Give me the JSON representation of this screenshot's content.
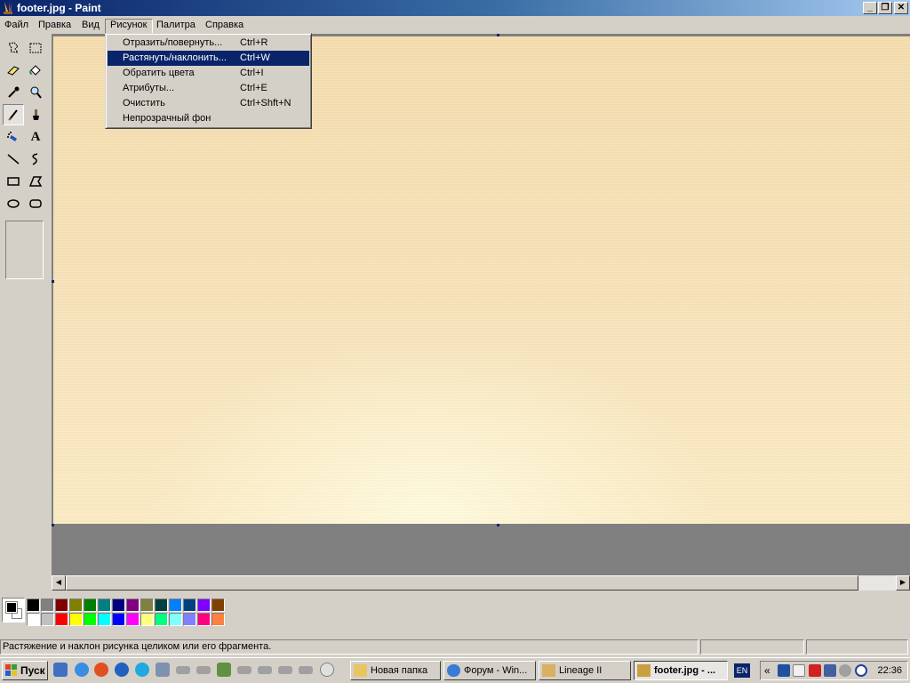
{
  "window": {
    "title": "footer.jpg - Paint",
    "buttons": {
      "minimize": "_",
      "restore": "❐",
      "close": "✕"
    }
  },
  "menubar": {
    "items": [
      "Файл",
      "Правка",
      "Вид",
      "Рисунок",
      "Палитра",
      "Справка"
    ],
    "open_menu": "Рисунок"
  },
  "dropdown": {
    "items": [
      {
        "label": "Отразить/повернуть...",
        "shortcut": "Ctrl+R"
      },
      {
        "label": "Растянуть/наклонить...",
        "shortcut": "Ctrl+W"
      },
      {
        "label": "Обратить цвета",
        "shortcut": "Ctrl+I"
      },
      {
        "label": "Атрибуты...",
        "shortcut": "Ctrl+E"
      },
      {
        "label": "Очистить",
        "shortcut": "Ctrl+Shft+N"
      },
      {
        "label": "Непрозрачный фон",
        "shortcut": ""
      }
    ],
    "highlighted_index": 1
  },
  "toolbox": {
    "tools": [
      "free-select",
      "rect-select",
      "eraser",
      "fill",
      "color-picker",
      "magnifier",
      "pencil",
      "brush",
      "airbrush",
      "text",
      "line",
      "curve",
      "rectangle",
      "polygon",
      "ellipse",
      "rounded-rectangle"
    ],
    "text_tool_glyph": "A",
    "active_tool": "pencil"
  },
  "palette": {
    "row1": [
      "#000000",
      "#808080",
      "#800000",
      "#808000",
      "#008000",
      "#008080",
      "#000080",
      "#800080",
      "#808040",
      "#004040",
      "#0080ff",
      "#004080",
      "#8000ff",
      "#804000"
    ],
    "row2": [
      "#ffffff",
      "#c0c0c0",
      "#ff0000",
      "#ffff00",
      "#00ff00",
      "#00ffff",
      "#0000ff",
      "#ff00ff",
      "#ffff80",
      "#00ff80",
      "#80ffff",
      "#8080ff",
      "#ff0080",
      "#ff8040"
    ],
    "foreground": "#000000",
    "background": "#ffffff"
  },
  "statusbar": {
    "text": "Растяжение и наклон рисунка целиком или его фрагмента."
  },
  "scrollbar": {
    "left_arrow": "◀",
    "right_arrow": "▶"
  },
  "taskbar": {
    "start_label": "Пуск",
    "tasks": [
      {
        "label": "Новая папка",
        "icon_color": "#e8c560"
      },
      {
        "label": "Форум - Win...",
        "icon_color": "#3a7bd5"
      },
      {
        "label": "Lineage II",
        "icon_color": "#d8b060"
      },
      {
        "label": "footer.jpg - ...",
        "icon_color": "#c8a040"
      }
    ],
    "active_task_index": 3,
    "lang": "EN",
    "tray_chevron": "«",
    "clock": "22:36"
  }
}
